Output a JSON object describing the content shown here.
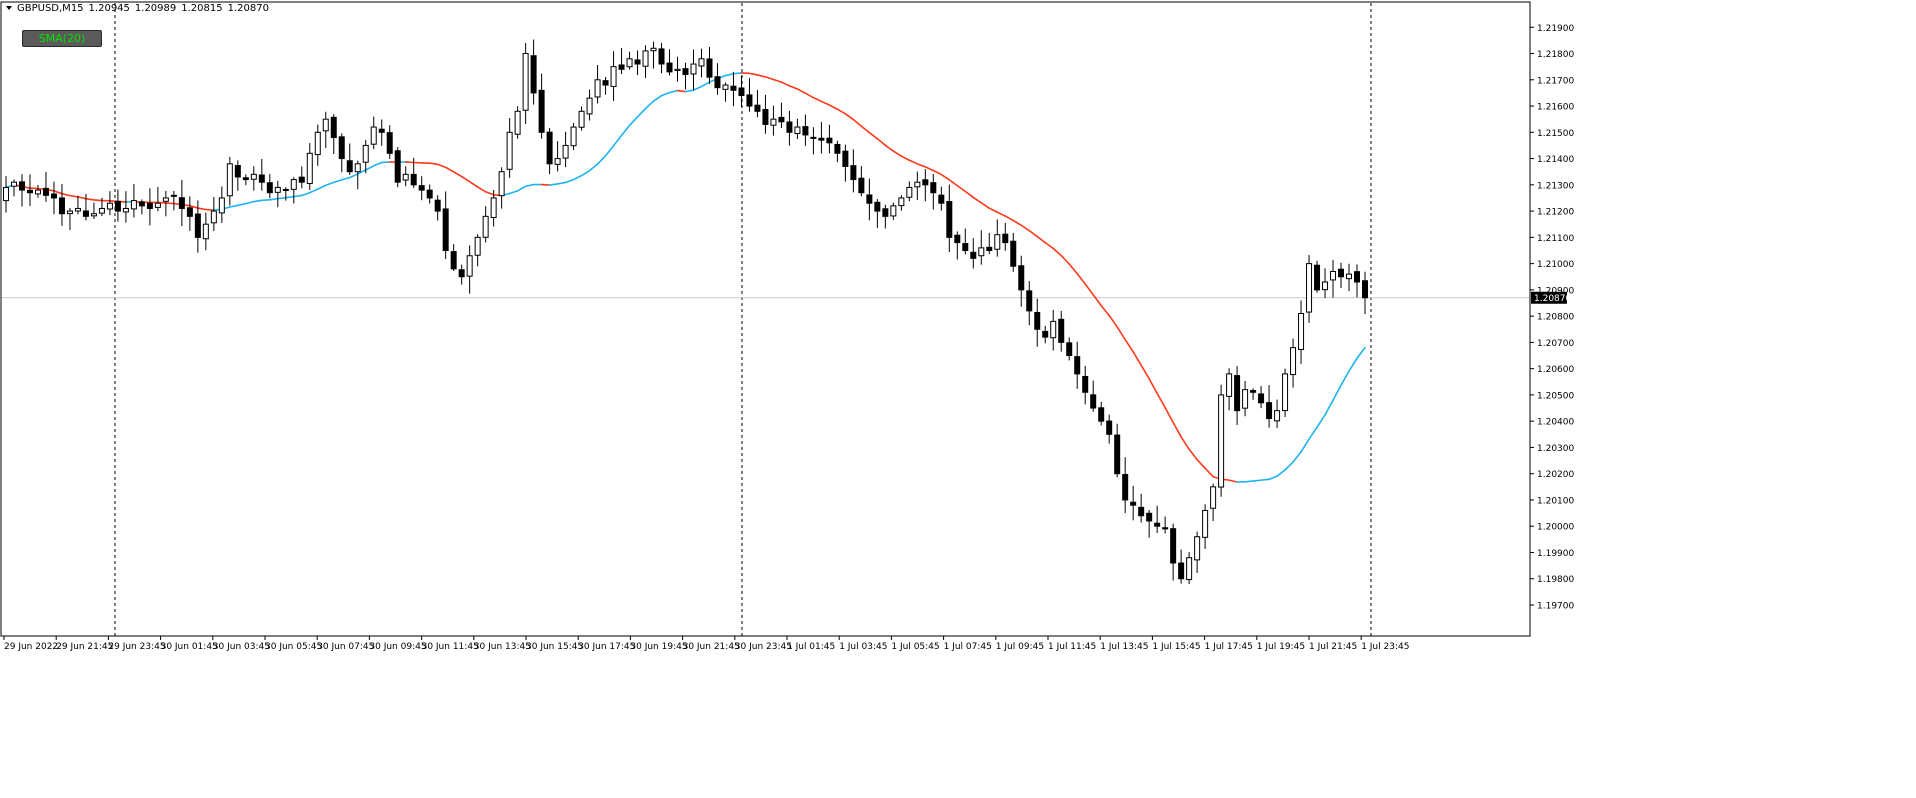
{
  "header": {
    "symbol": "GBPUSD,M15",
    "open": "1.20945",
    "high": "1.20989",
    "low": "1.20815",
    "close": "1.20870"
  },
  "indicator_button": {
    "label": "SMA(20)"
  },
  "colors": {
    "bull_candle": "#ffffff",
    "bear_candle": "#000000",
    "sma_falling": "#ff3a1a",
    "sma_rising": "#1eb4f0",
    "grid_separator": "#000000",
    "price_line": "#c8c8c8"
  },
  "chart_data": {
    "type": "candlestick",
    "symbol": "GBPUSD",
    "timeframe": "M15",
    "current_price": "1.20870",
    "y_ticks": [
      "1.21900",
      "1.21800",
      "1.21700",
      "1.21600",
      "1.21500",
      "1.21400",
      "1.21300",
      "1.21200",
      "1.21100",
      "1.21000",
      "1.20900",
      "1.20800",
      "1.20700",
      "1.20600",
      "1.20500",
      "1.20400",
      "1.20300",
      "1.20200",
      "1.20100",
      "1.20000",
      "1.19900",
      "1.19800",
      "1.19700"
    ],
    "ylim": [
      1.197,
      1.2195
    ],
    "x_ticks": [
      "29 Jun 2022",
      "29 Jun 21:45",
      "29 Jun 23:45",
      "30 Jun 01:45",
      "30 Jun 03:45",
      "30 Jun 05:45",
      "30 Jun 07:45",
      "30 Jun 09:45",
      "30 Jun 11:45",
      "30 Jun 13:45",
      "30 Jun 15:45",
      "30 Jun 17:45",
      "30 Jun 19:45",
      "30 Jun 21:45",
      "30 Jun 23:45",
      "1 Jul 01:45",
      "1 Jul 03:45",
      "1 Jul 05:45",
      "1 Jul 07:45",
      "1 Jul 09:45",
      "1 Jul 11:45",
      "1 Jul 13:45",
      "1 Jul 15:45",
      "1 Jul 17:45",
      "1 Jul 19:45",
      "1 Jul 21:45",
      "1 Jul 23:45"
    ],
    "close_path": [
      1.2129,
      1.2131,
      1.2128,
      1.2127,
      1.2128,
      1.2126,
      1.2125,
      1.2119,
      1.212,
      1.2121,
      1.2118,
      1.2119,
      1.2121,
      1.2123,
      1.212,
      1.2121,
      1.2124,
      1.2122,
      1.2121,
      1.2123,
      1.2125,
      1.2126,
      1.2121,
      1.2118,
      1.211,
      1.2115,
      1.212,
      1.2125,
      1.2138,
      1.2133,
      1.2132,
      1.2134,
      1.2131,
      1.2127,
      1.2129,
      1.2128,
      1.2132,
      1.2131,
      1.2142,
      1.215,
      1.2155,
      1.2148,
      1.214,
      1.2135,
      1.2138,
      1.2145,
      1.2152,
      1.215,
      1.2142,
      1.2131,
      1.2134,
      1.213,
      1.2128,
      1.2125,
      1.212,
      1.2105,
      1.2098,
      1.2095,
      1.2103,
      1.211,
      1.2118,
      1.2125,
      1.2135,
      1.215,
      1.2158,
      1.218,
      1.2165,
      1.215,
      1.2138,
      1.214,
      1.2145,
      1.2152,
      1.2158,
      1.2163,
      1.217,
      1.2168,
      1.2175,
      1.2174,
      1.2178,
      1.2176,
      1.2181,
      1.2182,
      1.2176,
      1.2173,
      1.2174,
      1.2172,
      1.2176,
      1.2178,
      1.2171,
      1.2167,
      1.2168,
      1.2166,
      1.2164,
      1.216,
      1.2158,
      1.2153,
      1.2155,
      1.2154,
      1.215,
      1.2152,
      1.2149,
      1.2148,
      1.2147,
      1.2146,
      1.2142,
      1.2137,
      1.2132,
      1.2127,
      1.2123,
      1.212,
      1.2118,
      1.2122,
      1.2125,
      1.2129,
      1.2131,
      1.213,
      1.2127,
      1.2123,
      1.211,
      1.2108,
      1.2105,
      1.2102,
      1.2106,
      1.2105,
      1.2111,
      1.2108,
      1.2099,
      1.209,
      1.2082,
      1.2075,
      1.2072,
      1.2078,
      1.207,
      1.2065,
      1.2058,
      1.2051,
      1.2045,
      1.204,
      1.2035,
      1.202,
      1.201,
      1.2008,
      1.2004,
      1.2002,
      1.2,
      1.1999,
      1.1986,
      1.198,
      1.1988,
      1.1996,
      1.2006,
      1.2015,
      1.205,
      1.2058,
      1.2044,
      1.2052,
      1.2051,
      1.2047,
      1.2041,
      1.2044,
      1.2058,
      1.2068,
      1.2081,
      1.21,
      1.209,
      1.2093,
      1.2097,
      1.2095,
      1.2096,
      1.2093,
      1.2087
    ]
  }
}
